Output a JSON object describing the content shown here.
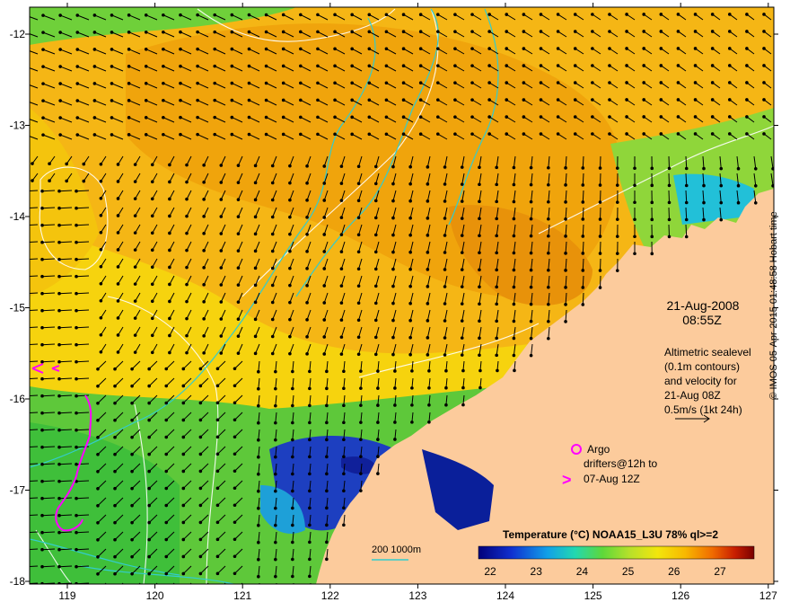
{
  "map": {
    "lon_ticks": [
      "119",
      "120",
      "121",
      "122",
      "123",
      "124",
      "125",
      "126",
      "127"
    ],
    "lat_ticks": [
      "-12",
      "-13",
      "-14",
      "-15",
      "-16",
      "-17",
      "-18"
    ],
    "date": "21-Aug-2008",
    "time": "08:55Z",
    "altimetry_lines": [
      "Altimetric sealevel",
      "(0.1m contours)",
      "and velocity for",
      "21-Aug 08Z",
      "0.5m/s (1kt 24h)"
    ],
    "argo_label": "Argo",
    "drifters_line1": "drifters@12h to",
    "drifters_line2": "07-Aug 12Z",
    "depth_legend": "200  1000m",
    "colorbar": {
      "title": "Temperature (°C) NOAA15_L3U 78% ql>=2",
      "ticks": [
        "22",
        "23",
        "24",
        "25",
        "26",
        "27"
      ]
    },
    "credit": "© IMOS 05-Apr-2015 01:48:58 Hobart time",
    "colors": {
      "land": "#fccb9c",
      "warm": "#f2a30a",
      "mid": "#f7d40c",
      "cool": "#46c83c",
      "cold": "#1d33b8",
      "bathy": "#33cccc",
      "drifter": "#ff00ff"
    }
  }
}
